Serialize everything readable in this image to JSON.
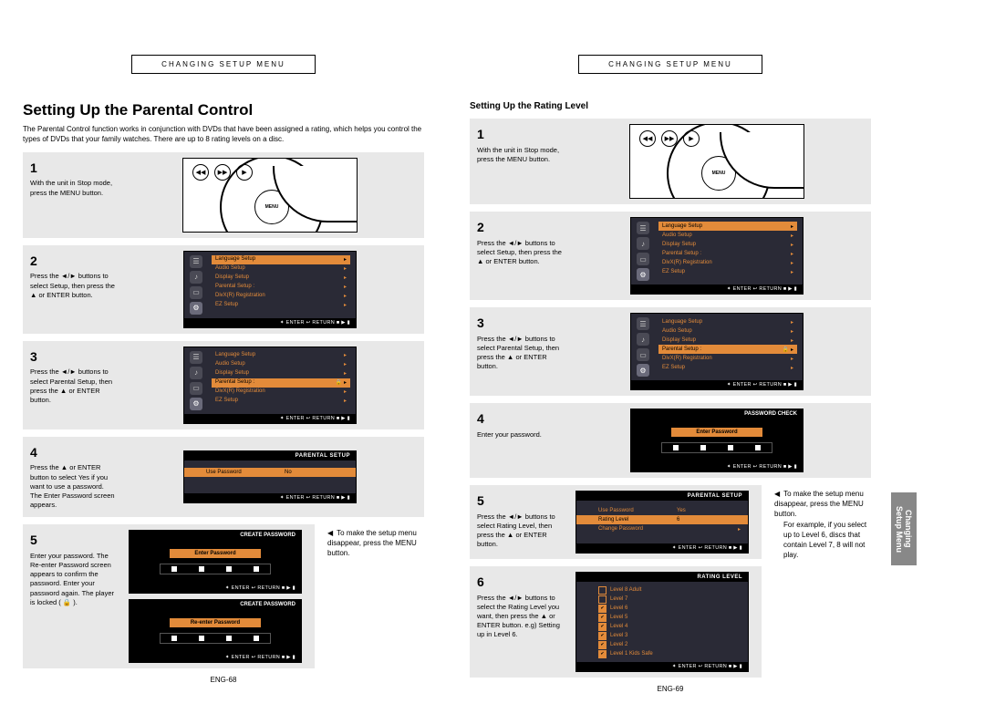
{
  "header": "CHANGING SETUP MENU",
  "title": "Setting Up the Parental Control",
  "intro": "The Parental Control function works in conjunction with DVDs that have been assigned a rating, which helps you control the types of DVDs that your family watches. There are up to 8 rating levels on a disc.",
  "subtitle_right": "Setting Up the Rating Level",
  "setup_menu": {
    "items": [
      "Language Setup",
      "Audio Setup",
      "Display Setup",
      "Parental Setup :",
      "DivX(R) Registration",
      "EZ Setup"
    ],
    "footer": "✦ ENTER   ↩ RETURN   ■ ▶ ▮"
  },
  "parental_setup": {
    "title": "PARENTAL SETUP",
    "rows": [
      {
        "label": "Use Password",
        "value": "No"
      }
    ],
    "rows2": [
      {
        "label": "Use Password",
        "value": "Yes"
      },
      {
        "label": "Rating Level",
        "value": "6"
      },
      {
        "label": "Change Password",
        "value": "",
        "arr": "▸"
      }
    ]
  },
  "password": {
    "create_title": "CREATE PASSWORD",
    "check_title": "PASSWORD CHECK",
    "enter": "Enter Password",
    "reenter": "Re-enter Password"
  },
  "rating": {
    "title": "RATING LEVEL",
    "levels": [
      "Level 8 Adult",
      "Level 7",
      "Level 6",
      "Level 5",
      "Level 4",
      "Level 3",
      "Level 2",
      "Level 1 Kids Safe"
    ]
  },
  "left_steps": {
    "s1": "With the unit in Stop mode, press the MENU button.",
    "s2": "Press the ◄/► buttons to select Setup, then press the ▲ or ENTER button.",
    "s3": "Press the ◄/► buttons to select Parental Setup, then press the ▲ or ENTER button.",
    "s4": "Press the ▲ or ENTER button to select Yes if you want to use a password. The Enter Password screen appears.",
    "s5": "Enter your password. The Re-enter Password screen appears to confirm the password. Enter your password again. The player is locked ( 🔒 )."
  },
  "right_steps": {
    "s1": "With the unit in Stop mode, press the MENU button.",
    "s2": "Press the ◄/► buttons to select Setup, then press the ▲ or ENTER button.",
    "s3": "Press the ◄/► buttons to select Parental Setup, then press the ▲ or ENTER button.",
    "s4": "Enter your password.",
    "s5": "Press the ◄/► buttons to select Rating Level, then press the ▲ or ENTER button.",
    "s6": "Press the ◄/► buttons to select the Rating Level you want, then press the ▲ or ENTER button. e.g) Setting up in Level 6."
  },
  "note_left": "To make the setup menu disappear, press the MENU button.",
  "note_right_a": "To make the setup menu disappear, press the MENU button.",
  "note_right_b": "For example, if you select up to Level 6, discs that contain Level 7, 8 will not play.",
  "tab": "Changing Setup Menu",
  "page_left": "ENG-68",
  "page_right": "ENG-69"
}
